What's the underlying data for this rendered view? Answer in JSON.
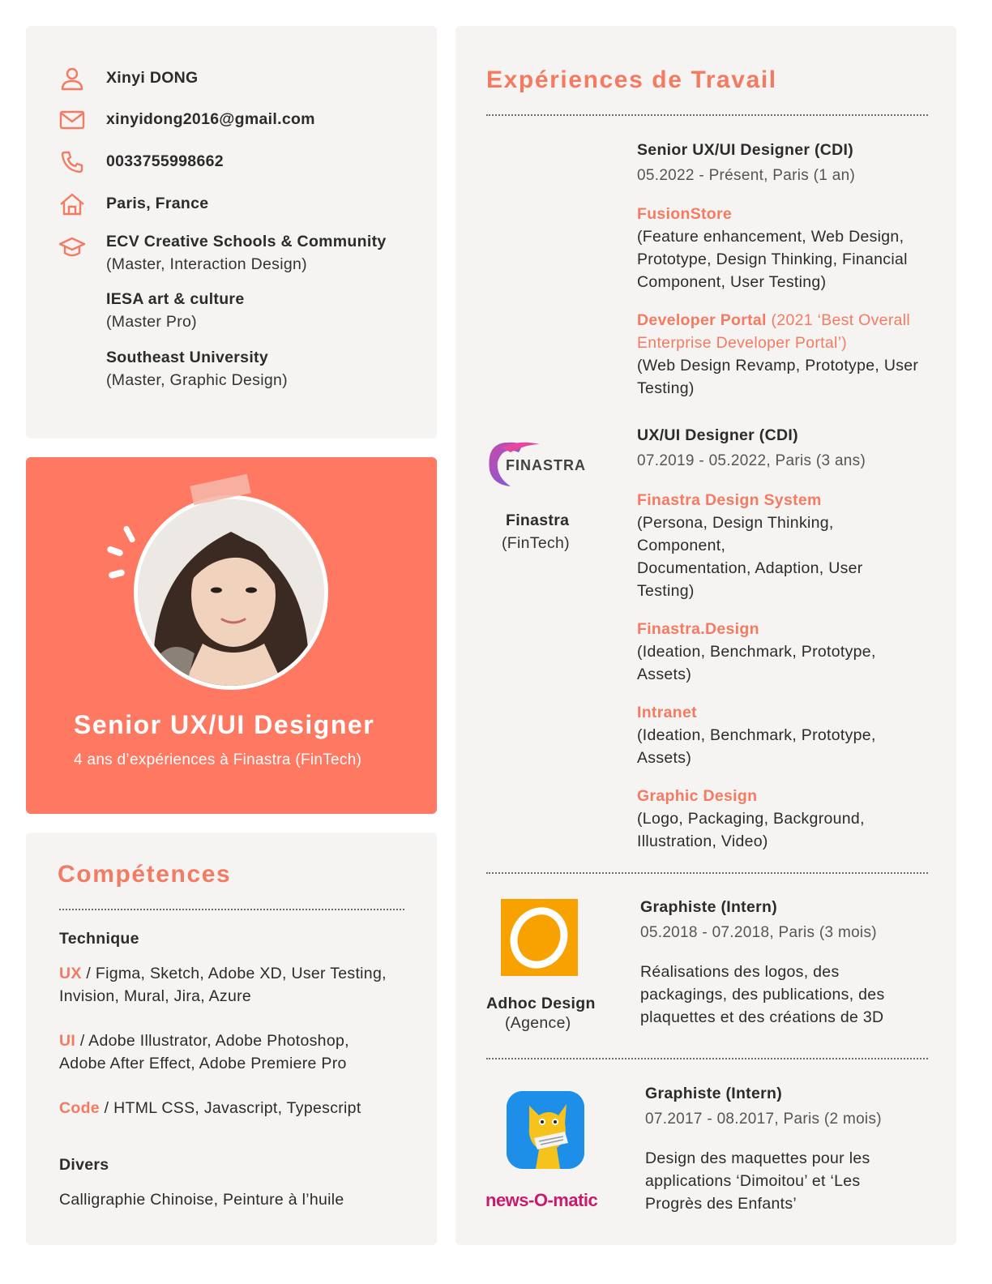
{
  "contact": {
    "name": "Xinyi DONG",
    "email": "xinyidong2016@gmail.com",
    "phone": "0033755998662",
    "location": "Paris, France",
    "education": [
      {
        "school": "ECV Creative Schools & Community",
        "degree": "(Master, Interaction Design)"
      },
      {
        "school": "IESA art & culture",
        "degree": "(Master Pro)"
      },
      {
        "school": "Southeast University",
        "degree": "(Master, Graphic Design)"
      }
    ],
    "icons": [
      "person-icon",
      "mail-icon",
      "phone-icon",
      "home-icon",
      "graduation-cap-icon"
    ]
  },
  "hero": {
    "title": "Senior UX/UI Designer",
    "subtitle": "4 ans d’expériences à Finastra (FinTech)"
  },
  "skills": {
    "title": "Compétences",
    "technique_heading": "Technique",
    "ux_key": "UX",
    "ux_line1": " / Figma, Sketch, Adobe XD, User Testing,",
    "ux_line2": "Invision, Mural, Jira, Azure",
    "ui_key": "UI",
    "ui_line1": " / Adobe Illustrator, Adobe Photoshop,",
    "ui_line2": "Adobe After Effect, Adobe Premiere Pro",
    "code_key": "Code",
    "code_line1": " / HTML CSS, Javascript, Typescript",
    "divers_heading": "Divers",
    "divers_line": "Calligraphie Chinoise, Peinture à l’huile"
  },
  "experience": {
    "title": "Expériences de Travail",
    "finastra": {
      "logo_text": "FINASTRA",
      "company": "Finastra",
      "type": "(FinTech)",
      "role1": {
        "title": "Senior UX/UI Designer (CDI)",
        "date": "05.2022 - Présent, Paris (1 an)",
        "projects": [
          {
            "name": "FusionStore",
            "lines": [
              "(Feature enhancement, Web Design,",
              "Prototype, Design Thinking, Financial",
              "Component, User Testing)"
            ]
          },
          {
            "name": "Developer Portal",
            "award1": " (2021 ‘Best Overall",
            "award2": "Enterprise Developer Portal’)",
            "lines": [
              "(Web Design Revamp, Prototype, User",
              "Testing)"
            ]
          }
        ]
      },
      "role2": {
        "title": "UX/UI Designer (CDI)",
        "date": "07.2019 - 05.2022, Paris (3 ans)",
        "projects": [
          {
            "name": "Finastra Design System",
            "lines": [
              "(Persona, Design Thinking,",
              "Component,",
              "Documentation, Adaption, User",
              "Testing)"
            ]
          },
          {
            "name": "Finastra.Design",
            "lines": [
              "(Ideation, Benchmark, Prototype,",
              "Assets)"
            ]
          },
          {
            "name": "Intranet",
            "lines": [
              "(Ideation, Benchmark, Prototype,",
              "Assets)"
            ]
          },
          {
            "name": "Graphic Design",
            "lines": [
              "(Logo, Packaging, Background,",
              "Illustration, Video)"
            ]
          }
        ]
      }
    },
    "adhoc": {
      "company": "Adhoc Design",
      "type": "(Agence)",
      "title": "Graphiste (Intern)",
      "date": "05.2018 - 07.2018, Paris (3 mois)",
      "desc": [
        "Réalisations des logos, des",
        "packagings, des publications, des",
        "plaquettes et des créations de 3D"
      ]
    },
    "newsomatic": {
      "logo_text": "news-O-matic",
      "title": "Graphiste (Intern)",
      "date": "07.2017 - 08.2017, Paris (2 mois)",
      "desc": [
        "Design des maquettes pour les",
        "applications ‘Dimoitou’ et ‘Les",
        "Progrès des Enfants’"
      ]
    }
  },
  "colors": {
    "accent": "#f47b62",
    "hero_bg": "#ff7861",
    "card_bg": "#f5f4f2",
    "adhoc_orange": "#f7a200",
    "newsomatic_blue": "#1e8fe8"
  }
}
